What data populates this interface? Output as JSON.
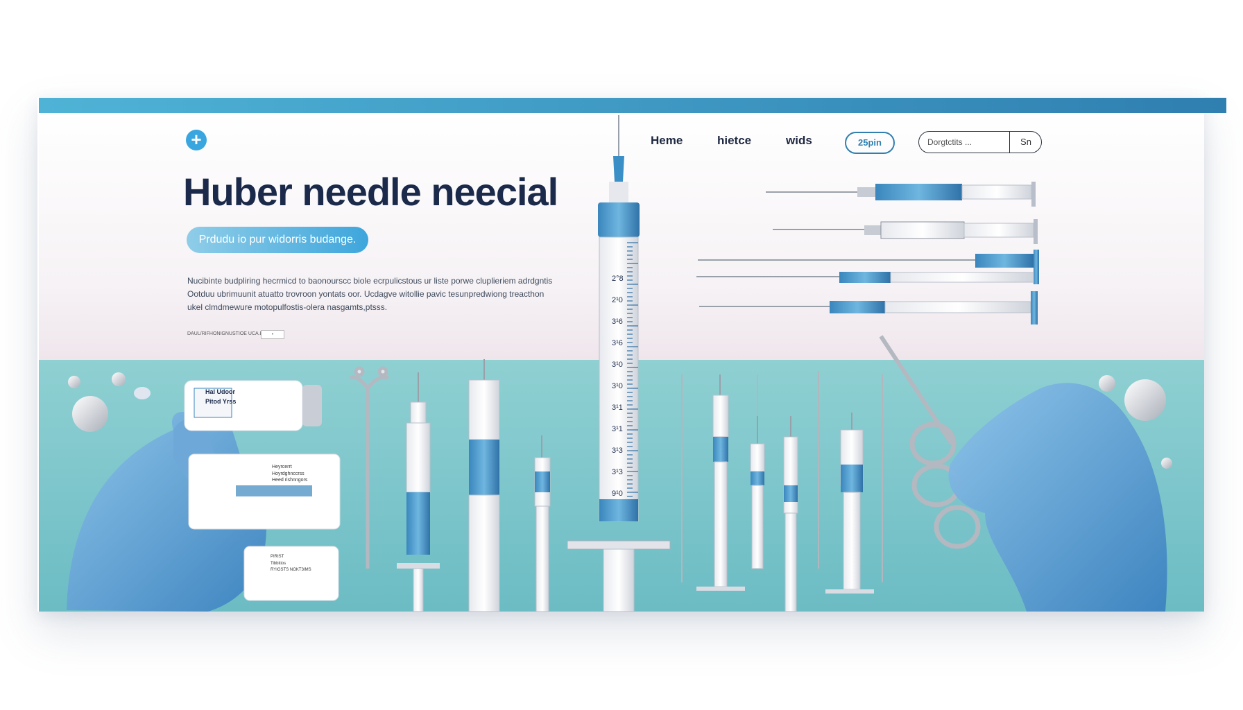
{
  "brand_icon": "plus-icon",
  "hero": {
    "title": "Huber needle neecial",
    "pill_label": "Prdudu io pur widorris budange.",
    "body_lines": [
      "Nucibinte budpliring hecrmicd to baonourscc biole ecrpulicstous ur liste porwe cluplieriem adrdgntis",
      "Ootduu ubrimuunit atuatto trovroon yontats oor. Ucdagve witollie pavic tesunpredwiong treacthon",
      "ukel clmdmewure motopulfostis-olera nasgamts,ptsss."
    ],
    "meta_text": "DAUL/RIFHONIGNUSTIOE    UCA.EXD",
    "meta_box_text": "•"
  },
  "nav": {
    "items": [
      "Heme",
      "hietce",
      "wids"
    ],
    "pill": "25pin",
    "search_placeholder": "Dorgtctits ...",
    "search_button": "Sn"
  },
  "syringe_scale": [
    "2°8",
    "2¹0",
    "3¹6",
    "3¹6",
    "3¹0",
    "3¹0",
    "3¹1",
    "3¹1",
    "3¹3",
    "3¹3",
    "9¹0"
  ],
  "product_box": {
    "line1": "Hal Udoor",
    "line2": "Pitod Yrss"
  },
  "cards": {
    "card1_header": "Heyrcerrt",
    "card1_lines": [
      "Hoyrdghnccrss",
      "Heed rishnngors"
    ],
    "card2_header": "PIRIST",
    "card2_lines": [
      "Tibbitios",
      "RYIGSTS NOKT3IMS"
    ]
  },
  "colors": {
    "accent": "#3aa6df",
    "navy": "#1b2a4a",
    "teal": "#7cc6cb",
    "glove": "#5fa6d8"
  }
}
